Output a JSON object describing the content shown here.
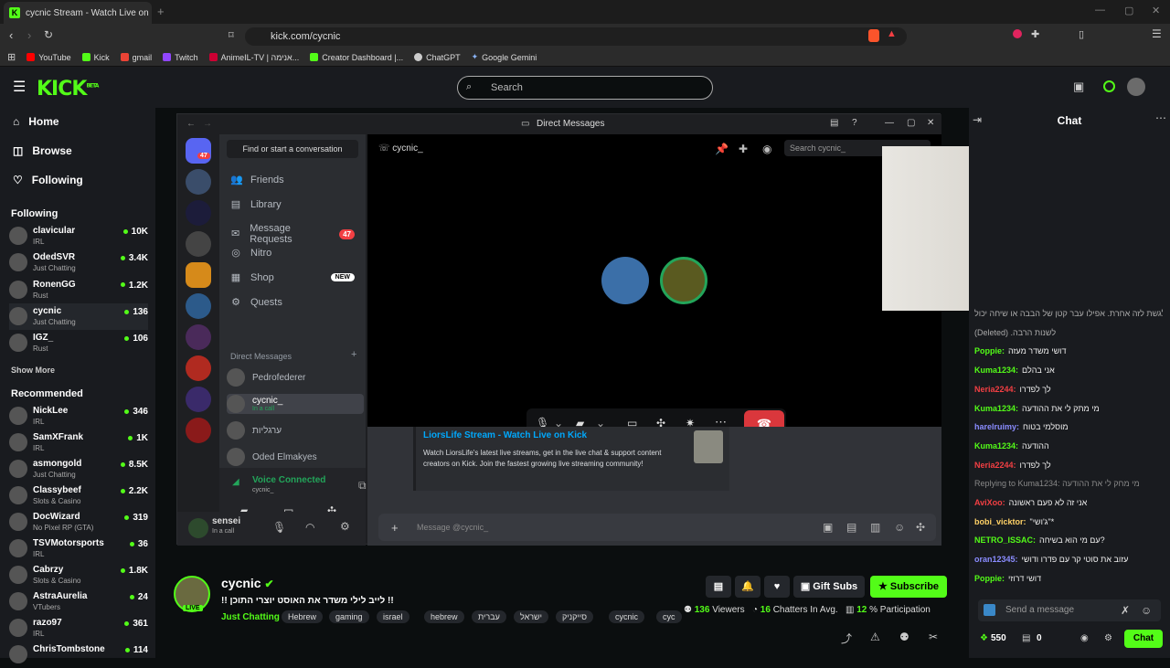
{
  "browser": {
    "tab_title": "cycnic Stream - Watch Live on K",
    "url": "kick.com/cycnic",
    "bookmarks": [
      "YouTube",
      "Kick",
      "gmail",
      "Twitch",
      "AnimeIL-TV | אנימה...",
      "Creator Dashboard |...",
      "ChatGPT",
      "Google Gemini"
    ]
  },
  "kick": {
    "logo": "KICK",
    "logo_sup": "BETA",
    "search_placeholder": "Search",
    "nav": [
      "Home",
      "Browse",
      "Following"
    ],
    "following_header": "Following",
    "following": [
      {
        "name": "clavicular",
        "cat": "IRL",
        "viewers": "10K"
      },
      {
        "name": "OdedSVR",
        "cat": "Just Chatting",
        "viewers": "3.4K"
      },
      {
        "name": "RonenGG",
        "cat": "Rust",
        "viewers": "1.2K"
      },
      {
        "name": "cycnic",
        "cat": "Just Chatting",
        "viewers": "136"
      },
      {
        "name": "IGZ_",
        "cat": "Rust",
        "viewers": "106"
      }
    ],
    "show_more": "Show More",
    "recommended_header": "Recommended",
    "recommended": [
      {
        "name": "NickLee",
        "cat": "IRL",
        "viewers": "346"
      },
      {
        "name": "SamXFrank",
        "cat": "IRL",
        "viewers": "1K"
      },
      {
        "name": "asmongold",
        "cat": "Just Chatting",
        "viewers": "8.5K"
      },
      {
        "name": "Classybeef",
        "cat": "Slots & Casino",
        "viewers": "2.2K"
      },
      {
        "name": "DocWizard",
        "cat": "No Pixel RP (GTA)",
        "viewers": "319"
      },
      {
        "name": "TSVMotorsports",
        "cat": "IRL",
        "viewers": "36"
      },
      {
        "name": "Cabrzy",
        "cat": "Slots & Casino",
        "viewers": "1.8K"
      },
      {
        "name": "AstraAurelia",
        "cat": "VTubers",
        "viewers": "24"
      },
      {
        "name": "razo97",
        "cat": "IRL",
        "viewers": "361"
      },
      {
        "name": "ChrisTombstone",
        "cat": "",
        "viewers": "114"
      }
    ]
  },
  "discord": {
    "title": "Direct Messages",
    "find": "Find or start a conversation",
    "nav": [
      {
        "label": "Friends",
        "icon": "👥",
        "badge": ""
      },
      {
        "label": "Library",
        "icon": "▤",
        "badge": ""
      },
      {
        "label": "Message Requests",
        "icon": "✉",
        "badge": "47"
      },
      {
        "label": "Nitro",
        "icon": "◎",
        "badge": ""
      },
      {
        "label": "Shop",
        "icon": "▦",
        "badge": "NEW"
      },
      {
        "label": "Quests",
        "icon": "⚙",
        "badge": ""
      }
    ],
    "dm_header": "Direct Messages",
    "dm_users": [
      {
        "name": "Pedrofederer",
        "sub": ""
      },
      {
        "name": "cycnic_",
        "sub": "In a call"
      },
      {
        "name": "ערגליות",
        "sub": ""
      },
      {
        "name": "Oded Elmakyes",
        "sub": ""
      }
    ],
    "home_badge": "47",
    "voice_connected": "Voice Connected",
    "voice_channel": "cycnic_",
    "user_name": "sensei",
    "user_status": "In a call",
    "call_user": "cycnic_",
    "search_placeholder": "Search cycnic_",
    "embed_title": "LiorsLife Stream - Watch Live on Kick",
    "embed_desc": "Watch LiorsLife's latest live streams, get in the live chat & support content creators on Kick. Join the fastest growing live streaming community!",
    "message_placeholder": "Message @cycnic_"
  },
  "chat": {
    "title": "Chat",
    "messages": [
      {
        "user": "",
        "text": "לגשת לזה אחרת. אפילו עבר קטן של הבבה או שיחה יכול",
        "color": "#aaaaaa"
      },
      {
        "user": "",
        "text": "(Deleted) .לשנות הרבה",
        "color": "#aaaaaa"
      },
      {
        "user": "Poppie:",
        "text": "דושי משדר מעזה",
        "color": "#53fc18"
      },
      {
        "user": "Kuma1234:",
        "text": "אני בהלם",
        "color": "#53fc18"
      },
      {
        "user": "Neria2244:",
        "text": "לך לפדרו",
        "color": "#f23f43"
      },
      {
        "user": "Kuma1234:",
        "text": "מי מתק לי את ההודעה",
        "color": "#53fc18"
      },
      {
        "user": "harelruimy:",
        "text": "מוסלמי בטוח",
        "color": "#8a8cff"
      },
      {
        "user": "Kuma1234:",
        "text": "ההודעה",
        "color": "#53fc18"
      },
      {
        "user": "Neria2244:",
        "text": "לך לפדרו",
        "color": "#f23f43"
      },
      {
        "user": "",
        "text": "Replying to Kuma1234: מי מחק לי את ההודעה",
        "color": "#888888"
      },
      {
        "user": "AviXoo:",
        "text": "אני זה לא פעם ראשונה",
        "color": "#f23f43"
      },
      {
        "user": "bobi_vicktor:",
        "text": "\"ג'ושי\"*",
        "color": "#ffd166"
      },
      {
        "user": "NETRO_ISSAC:",
        "text": "עם מי הוא בשיחה?",
        "color": "#53fc18"
      },
      {
        "user": "oran12345:",
        "text": "עזוב את סוטי קר עם פדרו ודושי",
        "color": "#8a8cff"
      },
      {
        "user": "Poppie:",
        "text": "דושי דרוזי",
        "color": "#53fc18"
      }
    ],
    "send_placeholder": "Send a message",
    "points": "550",
    "other": "0",
    "chat_button": "Chat"
  },
  "stream": {
    "name": "cycnic",
    "title": "!! לייב לילי משדר את האוסט יוצרי התוכן !!",
    "category": "Just Chatting",
    "live": "LIVE",
    "tags": [
      "Hebrew",
      "gaming",
      "israel",
      "hebrew",
      "עברית",
      "ישראל",
      "סייקניק",
      "cycnic",
      "cyc"
    ],
    "gift_subs": "Gift Subs",
    "subscribe": "Subscribe",
    "viewers": "136",
    "viewers_label": "Viewers",
    "chatters": "16",
    "chatters_label": "Chatters In Avg.",
    "participation": "12",
    "participation_label": "% Participation"
  },
  "colors": {
    "kick_green": "#53fc18",
    "discord_red": "#da373c",
    "discord_blurple": "#5865f2"
  }
}
